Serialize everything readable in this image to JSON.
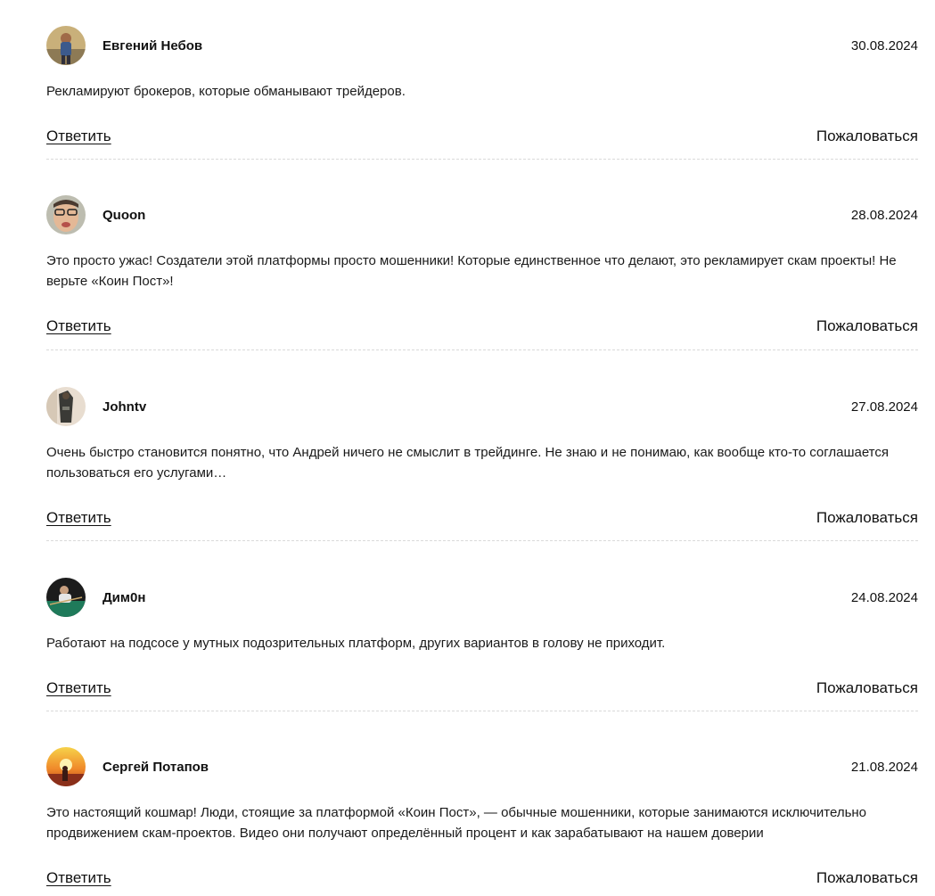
{
  "comments": [
    {
      "author": "Евгений Небов",
      "date": "30.08.2024",
      "text": "Рекламируют брокеров, которые обманывают трейдеров.",
      "reply_label": "Ответить",
      "report_label": "Пожаловаться"
    },
    {
      "author": "Quoon",
      "date": "28.08.2024",
      "text": "Это просто ужас! Создатели этой платформы просто мошенники! Которые единственное что делают, это рекламирует скам проекты! Не верьте «Коин Пост»!",
      "reply_label": "Ответить",
      "report_label": "Пожаловаться"
    },
    {
      "author": "Johntv",
      "date": "27.08.2024",
      "text": "Очень быстро становится понятно, что Андрей ничего не смыслит в трейдинге. Не знаю и не понимаю, как вообще кто-то соглашается пользоваться его услугами…",
      "reply_label": "Ответить",
      "report_label": "Пожаловаться"
    },
    {
      "author": "Дим0н",
      "date": "24.08.2024",
      "text": "Работают на подсосе у мутных подозрительных платформ, других вариантов в голову не приходит.",
      "reply_label": "Ответить",
      "report_label": "Пожаловаться"
    },
    {
      "author": "Сергей Потапов",
      "date": "21.08.2024",
      "text": "Это настоящий кошмар! Люди, стоящие за платформой «Коин Пост», — обычные мошенники, которые занимаются исключительно продвижением скам-проектов. Видео они получают определённый процент и как зарабатывают на нашем доверии",
      "reply_label": "Ответить",
      "report_label": "Пожаловаться"
    }
  ]
}
